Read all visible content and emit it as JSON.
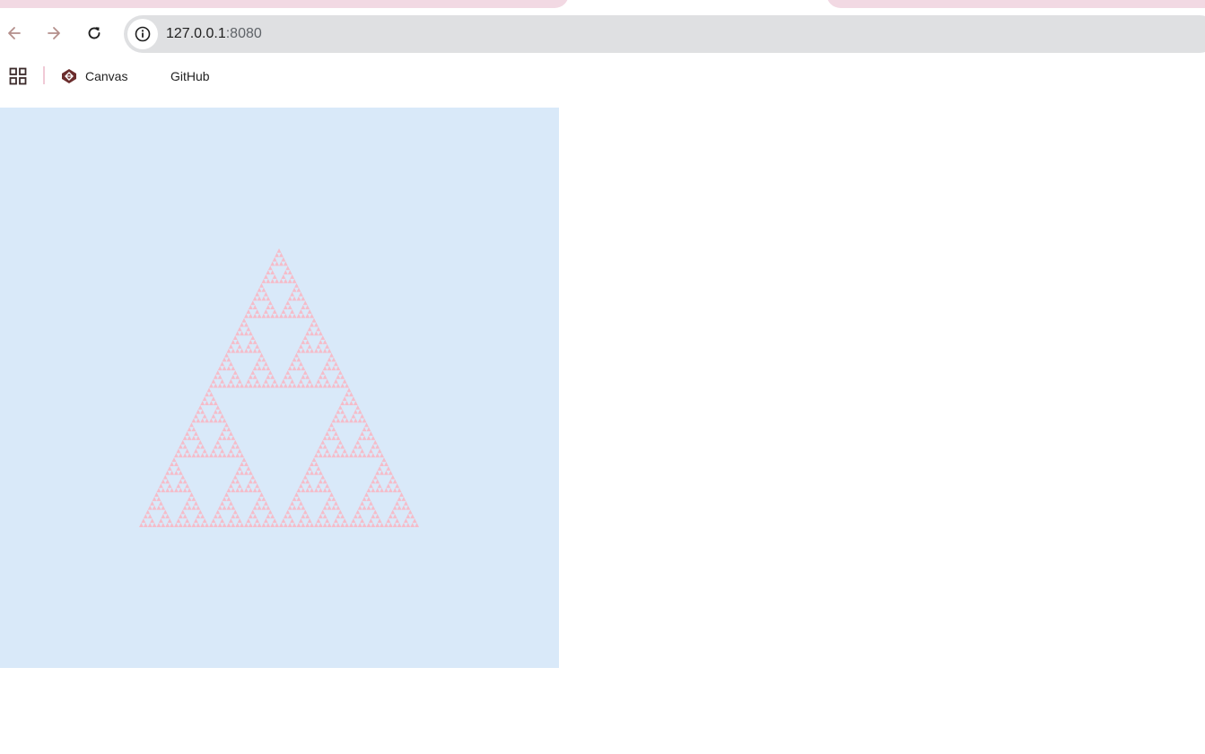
{
  "browser": {
    "address_bar": {
      "host": "127.0.0.1",
      "port": ":8080"
    },
    "bookmarks": [
      {
        "label": "Canvas",
        "icon": "canvas-favicon-icon"
      },
      {
        "label": "GitHub",
        "icon": ""
      }
    ]
  },
  "canvas": {
    "background": "#d9e9f9",
    "fractal": "sierpinski-triangle",
    "fractal_color": "#f5bcc9",
    "depth": 6
  },
  "colors": {
    "tab_pink": "#f2d9e3",
    "omnibox_gray": "#dfe0e2",
    "icon_brown": "#9a6f6a",
    "icon_dark": "#3b2a2a"
  }
}
